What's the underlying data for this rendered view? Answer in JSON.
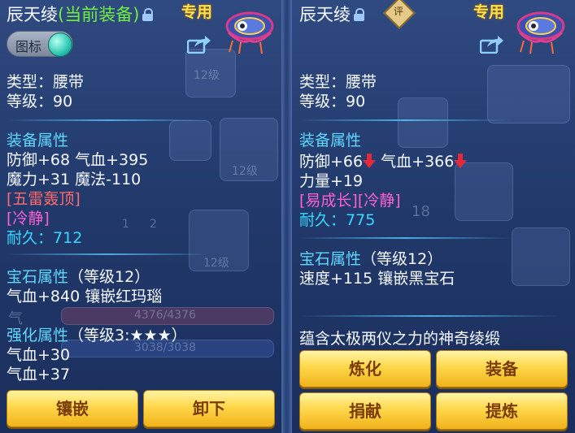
{
  "left": {
    "title_name": "辰天绫",
    "title_status": "(当前装备)",
    "exclusive": "专用",
    "toggle_label": "图标",
    "type_line": "类型：腰带",
    "level_line": "等级：90",
    "attr_header": "装备属性",
    "attr_line1": "防御+68 气血+395",
    "attr_line2": "魔力+31 魔法-110",
    "special1": "[五雷轰顶]",
    "special2": "[冷静]",
    "durability_label": "耐久：",
    "durability_value": "712",
    "gem_header": "宝石属性",
    "gem_level": "（等级12）",
    "gem_line": "气血+840 镶嵌红玛瑙",
    "enh_header": "强化属性",
    "enh_level": "（等级3:★★★）",
    "enh_line1": "气血+30",
    "enh_line2": "气血+37",
    "buttons": [
      "镶嵌",
      "卸下"
    ]
  },
  "right": {
    "title_name": "辰天绫",
    "rate_badge": "评",
    "exclusive": "专用",
    "type_line": "类型：腰带",
    "level_line": "等级：90",
    "attr_header": "装备属性",
    "attr_line1a": "防御+66",
    "attr_line1b": "气血+366",
    "attr_line2": "力量+19",
    "special": "[易成长][冷静]",
    "durability_label": "耐久：",
    "durability_value": "775",
    "gem_header": "宝石属性",
    "gem_level": "（等级12）",
    "gem_line": "速度+115 镶嵌黑宝石",
    "description": "蕴含太极两仪之力的神奇绫缎",
    "buttons": [
      "炼化",
      "装备",
      "捐献",
      "提炼"
    ]
  },
  "background": {
    "tags": [
      "12级",
      "12级",
      "12级",
      "18",
      "4376/4376",
      "3038/3038",
      "气",
      "1",
      "2"
    ]
  },
  "colors": {
    "accent_green": "#70ef3f",
    "section_blue": "#5fd8ff",
    "special_red": "#ff6a6a",
    "special_pink": "#ff5fd2",
    "durability_cyan": "#36d8ff",
    "exclusive_yellow": "#ffe04a",
    "button_gold": "#ffd74a"
  }
}
